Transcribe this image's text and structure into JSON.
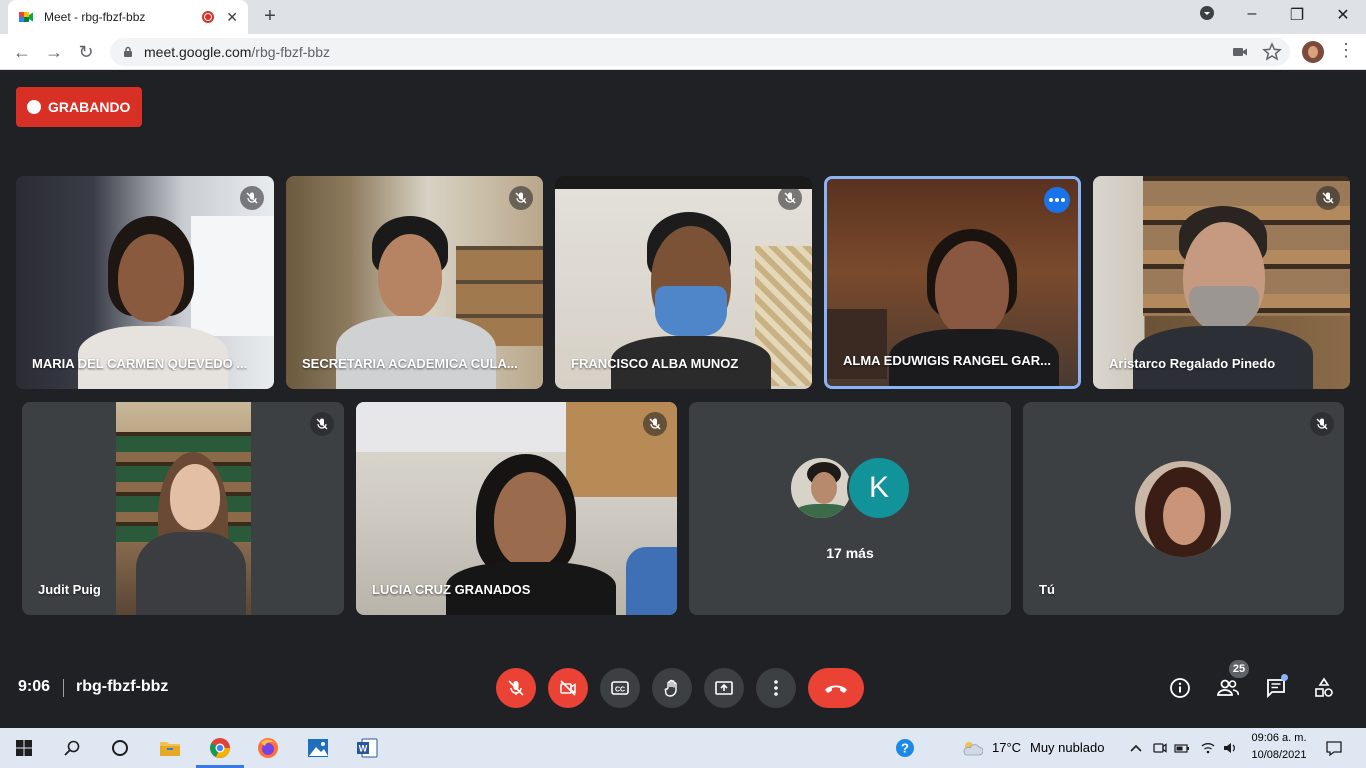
{
  "browser": {
    "tab_title": "Meet - rbg-fbzf-bbz",
    "url_host": "meet.google.com",
    "url_path": "/rbg-fbzf-bbz"
  },
  "recording": {
    "label": "GRABANDO"
  },
  "participants": [
    {
      "name": "MARIA DEL CARMEN QUEVEDO ...",
      "muted": true
    },
    {
      "name": "SECRETARIA ACADEMICA CULA...",
      "muted": true
    },
    {
      "name": "FRANCISCO ALBA MUNOZ",
      "muted": true
    },
    {
      "name": "ALMA EDUWIGIS RANGEL GAR...",
      "muted": false,
      "speaking": true
    },
    {
      "name": "Aristarco Regalado Pinedo",
      "muted": true
    },
    {
      "name": "Judit Puig",
      "muted": true
    },
    {
      "name": "LUCIA CRUZ GRANADOS",
      "muted": true
    },
    {
      "name": "",
      "overflow_label": "17 más",
      "avatar_letter": "K"
    },
    {
      "name": "Tú",
      "muted": true
    }
  ],
  "meeting": {
    "time": "9:06",
    "code": "rbg-fbzf-bbz",
    "participant_count": "25"
  },
  "taskbar": {
    "weather_temp": "17°C",
    "weather_desc": "Muy nublado",
    "time": "09:06 a. m.",
    "date": "10/08/2021"
  },
  "colors": {
    "meet_bg": "#202124",
    "tile_bg": "#3c4043",
    "red": "#ea4335",
    "active_border": "#8ab4f8",
    "avatar_k": "#12939a"
  }
}
